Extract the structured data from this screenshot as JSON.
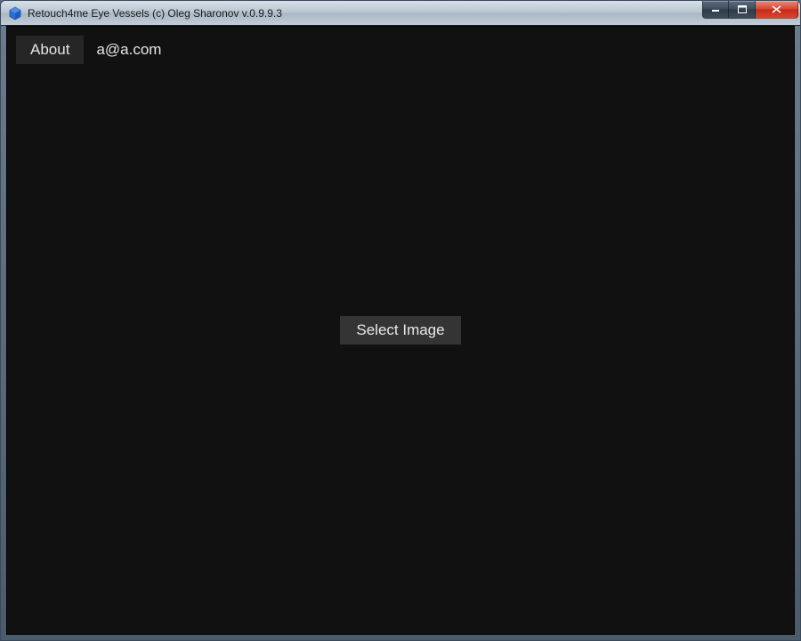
{
  "window": {
    "title": "Retouch4me Eye Vessels (c) Oleg Sharonov v.0.9.9.3"
  },
  "toolbar": {
    "about_label": "About",
    "email": "a@a.com"
  },
  "main": {
    "select_image_label": "Select Image"
  }
}
